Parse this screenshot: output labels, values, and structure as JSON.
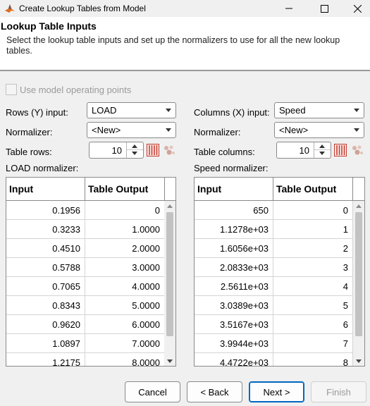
{
  "window": {
    "title": "Create Lookup Tables from Model"
  },
  "header": {
    "title": "Lookup Table Inputs",
    "description": "Select the lookup table inputs and set up the normalizers to use for all the new lookup tables."
  },
  "use_operating_points": {
    "label": "Use model operating points",
    "checked": false,
    "enabled": false
  },
  "rows": {
    "input_label": "Rows (Y) input:",
    "input_value": "LOAD",
    "normalizer_label": "Normalizer:",
    "normalizer_value": "<New>",
    "count_label": "Table rows:",
    "count_value": "10",
    "normalizer_table_label": "LOAD normalizer:"
  },
  "cols": {
    "input_label": "Columns (X) input:",
    "input_value": "Speed",
    "normalizer_label": "Normalizer:",
    "normalizer_value": "<New>",
    "count_label": "Table columns:",
    "count_value": "10",
    "normalizer_table_label": "Speed normalizer:"
  },
  "load_table": {
    "headers": [
      "Input",
      "Table Output"
    ],
    "rows": [
      [
        "0.1956",
        "0"
      ],
      [
        "0.3233",
        "1.0000"
      ],
      [
        "0.4510",
        "2.0000"
      ],
      [
        "0.5788",
        "3.0000"
      ],
      [
        "0.7065",
        "4.0000"
      ],
      [
        "0.8343",
        "5.0000"
      ],
      [
        "0.9620",
        "6.0000"
      ],
      [
        "1.0897",
        "7.0000"
      ],
      [
        "1.2175",
        "8.0000"
      ]
    ]
  },
  "speed_table": {
    "headers": [
      "Input",
      "Table Output"
    ],
    "rows": [
      [
        "650",
        "0"
      ],
      [
        "1.1278e+03",
        "1"
      ],
      [
        "1.6056e+03",
        "2"
      ],
      [
        "2.0833e+03",
        "3"
      ],
      [
        "2.5611e+03",
        "4"
      ],
      [
        "3.0389e+03",
        "5"
      ],
      [
        "3.5167e+03",
        "6"
      ],
      [
        "3.9944e+03",
        "7"
      ],
      [
        "4.4722e+03",
        "8"
      ]
    ]
  },
  "buttons": {
    "cancel": "Cancel",
    "back": "< Back",
    "next": "Next >",
    "finish": "Finish"
  },
  "colors": {
    "accent": "#0067c0",
    "icon_red": "#c0392b"
  }
}
